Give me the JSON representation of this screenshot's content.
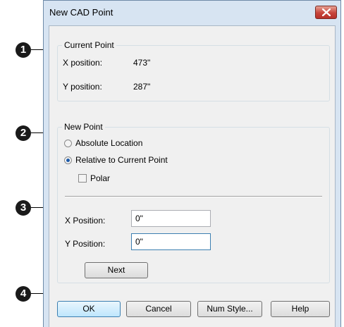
{
  "dialog": {
    "title": "New CAD Point"
  },
  "current_point": {
    "group_label": "Current Point",
    "x_label": "X position:",
    "x_value": "473\"",
    "y_label": "Y position:",
    "y_value": "287\""
  },
  "new_point": {
    "group_label": "New Point",
    "absolute_label": "Absolute Location",
    "relative_label": "Relative to Current Point",
    "relative_selected": true,
    "polar_label": "Polar",
    "polar_checked": false,
    "x_label": "X Position:",
    "x_value": "0\"",
    "y_label": "Y Position:",
    "y_value": "0\"",
    "next_label": "Next"
  },
  "buttons": {
    "ok": "OK",
    "cancel": "Cancel",
    "num_style": "Num Style...",
    "help": "Help"
  },
  "callouts": [
    "1",
    "2",
    "3",
    "4"
  ],
  "colors": {
    "frame": "#d7e4f2",
    "client": "#f0f0f0",
    "close": "#c7443a",
    "callout": "#1a1a1a"
  },
  "icons": {
    "close": "close-x-icon"
  }
}
